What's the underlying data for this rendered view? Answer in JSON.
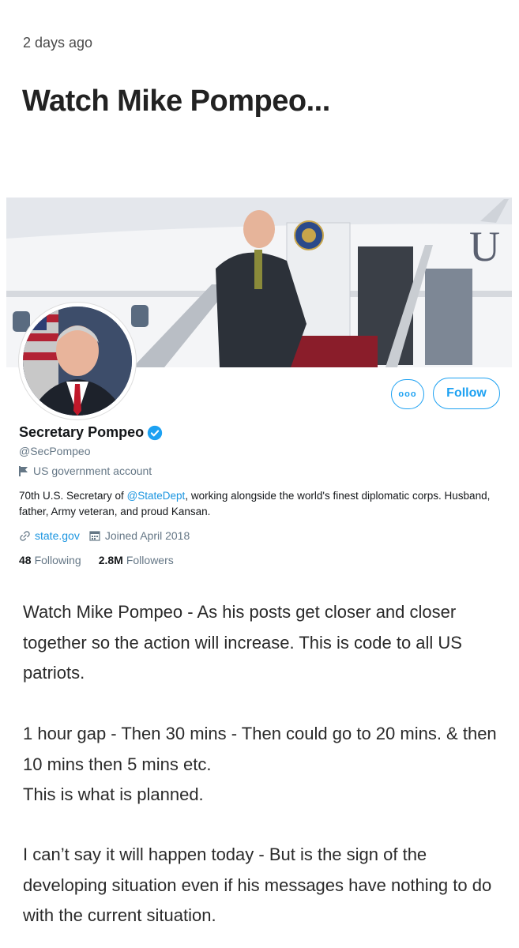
{
  "post": {
    "timestamp": "2 days ago",
    "headline": "Watch Mike Pompeo...",
    "paragraphs": [
      "Watch Mike Pompeo - As his posts get closer and closer together so the action will increase. This is code to all US patriots.",
      "1 hour gap - Then 30 mins - Then could go to 20 mins. & then 10 mins then 5 mins etc.",
      "This is what is planned.",
      "I can’t say it will happen today - But is the sign of the developing situation even if his messages have nothing to do with the current situation."
    ]
  },
  "profile": {
    "more_label": "ooo",
    "follow_label": "Follow",
    "name": "Secretary Pompeo",
    "handle": "@SecPompeo",
    "gov_label": "US government account",
    "bio_before": "70th U.S. Secretary of ",
    "bio_link": "@StateDept",
    "bio_after": ", working alongside the world's finest diplomatic corps. Husband, father, Army veteran, and proud Kansan.",
    "website": "state.gov",
    "joined": "Joined April 2018",
    "following_count": "48",
    "following_label": "Following",
    "followers_count": "2.8M",
    "followers_label": "Followers"
  },
  "icons": {
    "verified": "verified-badge-icon",
    "gov": "flag-icon",
    "link": "link-icon",
    "calendar": "calendar-icon"
  },
  "colors": {
    "twitter_blue": "#1da1f2",
    "link_blue": "#1b95e0",
    "muted_gray": "#657786"
  }
}
